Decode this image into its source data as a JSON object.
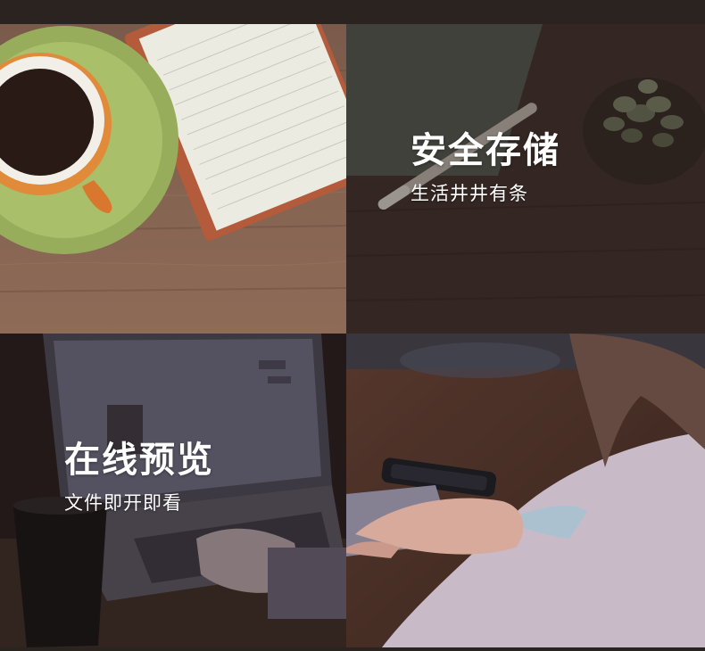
{
  "features": [
    {
      "title": "安全存储",
      "subtitle": "生活井井有条"
    },
    {
      "title": "在线预览",
      "subtitle": "文件即开即看"
    }
  ],
  "colors": {
    "wood_light": "#8a6a56",
    "wood_dark": "#3b2a26",
    "saucer_green": "#a9bf6a",
    "notebook_orange": "#b85a3a",
    "overlay_dark": "#2a1f1c",
    "text": "#ffffff"
  },
  "icons": []
}
